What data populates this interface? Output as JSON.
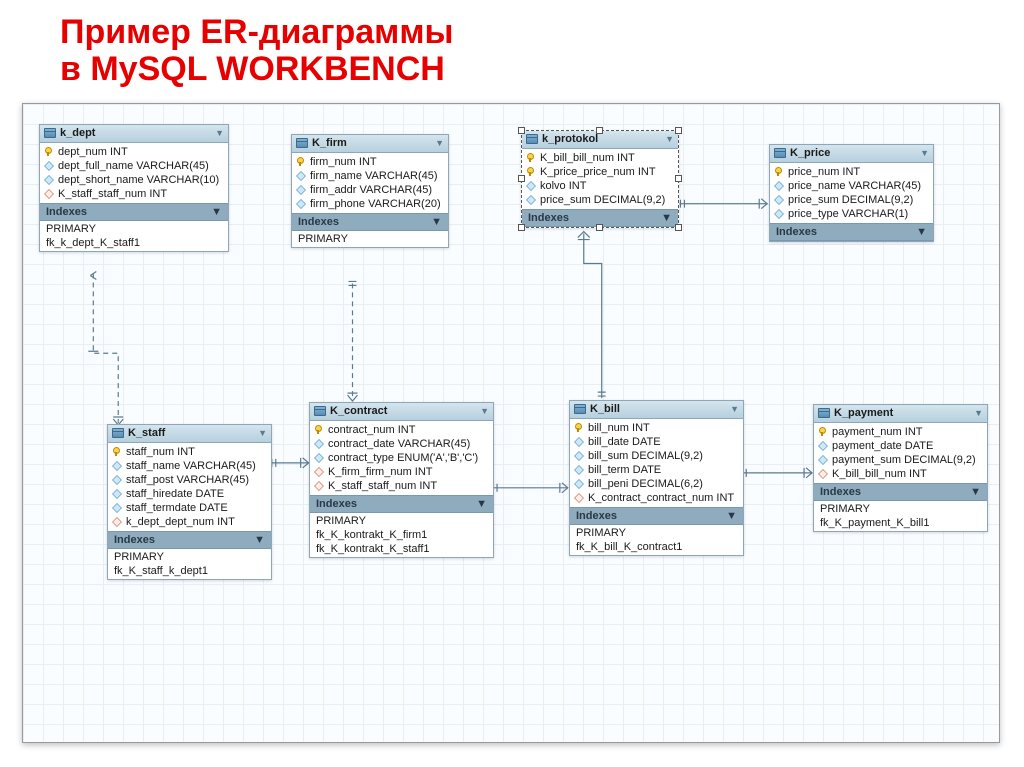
{
  "title_line1": "Пример ER-диаграммы",
  "title_line2": "в MySQL WORKBENCH",
  "indexes_label": "Indexes",
  "collapse_glyph": "▼",
  "tables": {
    "k_dept": {
      "name": "k_dept",
      "columns": [
        {
          "icon": "pk",
          "text": "dept_num INT"
        },
        {
          "icon": "col",
          "text": "dept_full_name VARCHAR(45)"
        },
        {
          "icon": "col",
          "text": "dept_short_name VARCHAR(10)"
        },
        {
          "icon": "fk",
          "text": "K_staff_staff_num INT"
        }
      ],
      "indexes": [
        "PRIMARY",
        "fk_k_dept_K_staff1"
      ]
    },
    "k_firm": {
      "name": "K_firm",
      "columns": [
        {
          "icon": "pk",
          "text": "firm_num INT"
        },
        {
          "icon": "col",
          "text": "firm_name VARCHAR(45)"
        },
        {
          "icon": "col",
          "text": "firm_addr VARCHAR(45)"
        },
        {
          "icon": "col",
          "text": "firm_phone VARCHAR(20)"
        }
      ],
      "indexes": [
        "PRIMARY"
      ]
    },
    "k_protokol": {
      "name": "k_protokol",
      "columns": [
        {
          "icon": "pk",
          "text": "K_bill_bill_num INT"
        },
        {
          "icon": "pk",
          "text": "K_price_price_num INT"
        },
        {
          "icon": "col",
          "text": "kolvo INT"
        },
        {
          "icon": "col",
          "text": "price_sum DECIMAL(9,2)"
        }
      ],
      "indexes": []
    },
    "k_price": {
      "name": "K_price",
      "columns": [
        {
          "icon": "pk",
          "text": "price_num INT"
        },
        {
          "icon": "col",
          "text": "price_name VARCHAR(45)"
        },
        {
          "icon": "col",
          "text": "price_sum DECIMAL(9,2)"
        },
        {
          "icon": "col",
          "text": "price_type VARCHAR(1)"
        }
      ],
      "indexes": []
    },
    "k_staff": {
      "name": "K_staff",
      "columns": [
        {
          "icon": "pk",
          "text": "staff_num INT"
        },
        {
          "icon": "col",
          "text": "staff_name VARCHAR(45)"
        },
        {
          "icon": "col",
          "text": "staff_post VARCHAR(45)"
        },
        {
          "icon": "col",
          "text": "staff_hiredate DATE"
        },
        {
          "icon": "col",
          "text": "staff_termdate DATE"
        },
        {
          "icon": "fk",
          "text": "k_dept_dept_num INT"
        }
      ],
      "indexes": [
        "PRIMARY",
        "fk_K_staff_k_dept1"
      ]
    },
    "k_contract": {
      "name": "K_contract",
      "columns": [
        {
          "icon": "pk",
          "text": "contract_num INT"
        },
        {
          "icon": "col",
          "text": "contract_date VARCHAR(45)"
        },
        {
          "icon": "col",
          "text": "contract_type ENUM('A','B','C')"
        },
        {
          "icon": "fk",
          "text": "K_firm_firm_num INT"
        },
        {
          "icon": "fk",
          "text": "K_staff_staff_num INT"
        }
      ],
      "indexes": [
        "PRIMARY",
        "fk_K_kontrakt_K_firm1",
        "fk_K_kontrakt_K_staff1"
      ]
    },
    "k_bill": {
      "name": "K_bill",
      "columns": [
        {
          "icon": "pk",
          "text": "bill_num INT"
        },
        {
          "icon": "col",
          "text": "bill_date DATE"
        },
        {
          "icon": "col",
          "text": "bill_sum DECIMAL(9,2)"
        },
        {
          "icon": "col",
          "text": "bill_term DATE"
        },
        {
          "icon": "col",
          "text": "bill_peni DECIMAL(6,2)"
        },
        {
          "icon": "fk",
          "text": "K_contract_contract_num INT"
        }
      ],
      "indexes": [
        "PRIMARY",
        "fk_K_bill_K_contract1"
      ]
    },
    "k_payment": {
      "name": "K_payment",
      "columns": [
        {
          "icon": "pk",
          "text": "payment_num INT"
        },
        {
          "icon": "col",
          "text": "payment_date DATE"
        },
        {
          "icon": "col",
          "text": "payment_sum DECIMAL(9,2)"
        },
        {
          "icon": "fk",
          "text": "K_bill_bill_num INT"
        }
      ],
      "indexes": [
        "PRIMARY",
        "fk_K_payment_K_bill1"
      ]
    }
  }
}
